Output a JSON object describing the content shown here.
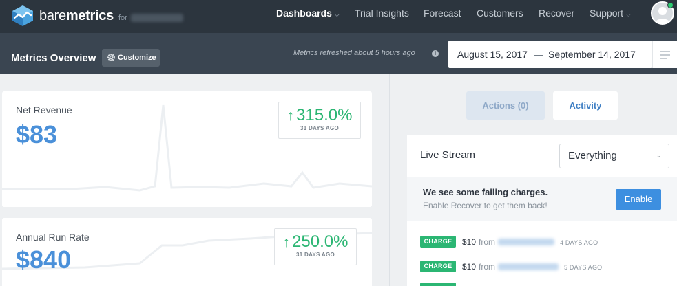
{
  "brand": {
    "name_light": "bare",
    "name_bold": "metrics",
    "for_label": "for"
  },
  "nav": {
    "dashboards": "Dashboards",
    "trial_insights": "Trial Insights",
    "forecast": "Forecast",
    "customers": "Customers",
    "recover": "Recover",
    "support": "Support"
  },
  "header": {
    "title": "Metrics Overview",
    "customize_label": "Customize",
    "refreshed_text": "Metrics refreshed about 5 hours ago",
    "date_from": "August 15, 2017",
    "date_separator": "—",
    "date_to": "September 14, 2017"
  },
  "metrics": [
    {
      "label": "Net Revenue",
      "value": "$83",
      "growth": "315.0%",
      "growth_period": "31 DAYS AGO"
    },
    {
      "label": "Annual Run Rate",
      "value": "$840",
      "growth": "250.0%",
      "growth_period": "31 DAYS AGO"
    }
  ],
  "tabs": {
    "actions": "Actions (0)",
    "activity": "Activity"
  },
  "stream": {
    "title": "Live Stream",
    "filter_value": "Everything",
    "alert_title": "We see some failing charges.",
    "alert_subtitle": "Enable Recover to get them back!",
    "enable_label": "Enable",
    "from_label": "from",
    "events": [
      {
        "type": "CHARGE",
        "amount": "$10",
        "ago": "4 DAYS AGO"
      },
      {
        "type": "CHARGE",
        "amount": "$10",
        "ago": "5 DAYS AGO"
      }
    ]
  },
  "colors": {
    "nav_bg": "#2c353e",
    "subbar_bg": "#3a4551",
    "accent_blue": "#4a90d9",
    "growth_green": "#2bb673",
    "enable_blue": "#3d8fe0"
  }
}
